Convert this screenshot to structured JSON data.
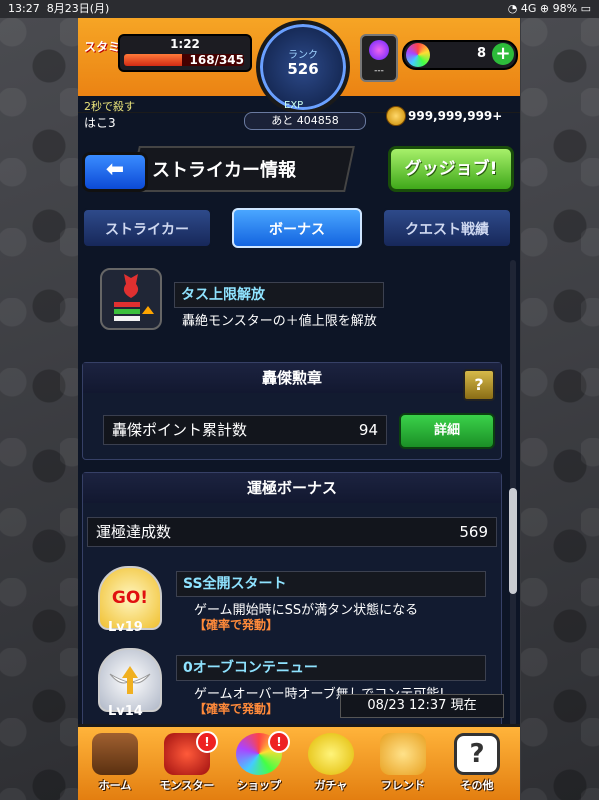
{
  "status_bar": {
    "time": "13:27",
    "date": "8月23日(月)",
    "network": "4G",
    "battery": "98%"
  },
  "header": {
    "stamina_label": "スタミナ",
    "stamina_timer": "1:22",
    "stamina_value": "168/345",
    "stamina_fraction": 0.487,
    "rank_label": "ランク",
    "rank_value": "526",
    "exp_label": "EXP",
    "exp_remaining": "あと 404858",
    "egg_dash": "---",
    "orb_count": "8",
    "plus": "+",
    "kill_text": "2秒で殺す",
    "player_name": "はこ3",
    "coins": "999,999,999+"
  },
  "title_bar": {
    "back": "⬅",
    "title": "ストライカー情報",
    "good_button": "グッジョブ!"
  },
  "tabs": [
    {
      "label": "ストライカー",
      "active": false
    },
    {
      "label": "ボーナス",
      "active": true
    },
    {
      "label": "クエスト戦績",
      "active": false
    }
  ],
  "bonus_top": {
    "name": "タス上限解放",
    "desc": "轟絶モンスターの＋値上限を解放"
  },
  "gouketsu": {
    "title": "轟傑勲章",
    "help": "?",
    "points_label": "轟傑ポイント累計数",
    "points_value": "94",
    "detail_button": "詳細"
  },
  "unkyoku": {
    "title": "運極ボーナス",
    "count_label": "運極達成数",
    "count_value": "569",
    "items": [
      {
        "name": "SS全開スタート",
        "desc": "ゲーム開始時にSSが満タン状態になる",
        "prob": "【確率で発動】",
        "level": "Lv19",
        "icon_text": "GO!"
      },
      {
        "name": "0オーブコンテニュー",
        "desc": "ゲームオーバー時オーブ無しでコンテ可能!",
        "prob": "【確率で発動】",
        "level": "Lv14"
      }
    ]
  },
  "timestamp": "08/23 12:37 現在",
  "nav": [
    {
      "label": "ホーム",
      "badge": ""
    },
    {
      "label": "モンスター",
      "badge": "!"
    },
    {
      "label": "ショップ",
      "badge": "!"
    },
    {
      "label": "ガチャ",
      "badge": ""
    },
    {
      "label": "フレンド",
      "badge": ""
    },
    {
      "label": "その他",
      "badge": ""
    }
  ],
  "colors": {
    "accent_orange": "#f0901a",
    "tab_active": "#1f7cf0",
    "green_button": "#2fb83a",
    "label_cyan": "#8fe3ff",
    "prob_orange": "#ff8a3a"
  }
}
